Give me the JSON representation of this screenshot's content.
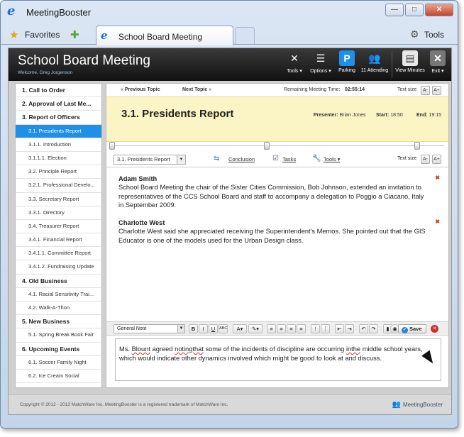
{
  "browser": {
    "title": "MeetingBooster",
    "favorites_label": "Favorites",
    "tab_title": "School Board Meeting",
    "tools_label": "Tools"
  },
  "app": {
    "title": "School Board Meeting",
    "welcome": "Welcome, Greg Jorgenson",
    "header_buttons": [
      "Tools",
      "Options",
      "Parking",
      "11 Attending",
      "View Minutes",
      "Exit"
    ]
  },
  "sidebar": {
    "items": [
      {
        "label": "1. Call to Order",
        "level": "h"
      },
      {
        "label": "2. Approval of Last Me...",
        "level": "h"
      },
      {
        "label": "3. Report of Officers",
        "level": "h"
      },
      {
        "label": "3.1. Presidents Report",
        "level": "sub",
        "active": true
      },
      {
        "label": "3.1.1. Introduction",
        "level": "sub"
      },
      {
        "label": "3.1.1.1. Election",
        "level": "sub"
      },
      {
        "label": "3.2. Principle Report",
        "level": "sub"
      },
      {
        "label": "3.2.1. Professional Develo...",
        "level": "sub"
      },
      {
        "label": "3.3. Secretary Report",
        "level": "sub"
      },
      {
        "label": "3.3.1. Directory",
        "level": "sub"
      },
      {
        "label": "3.4. Treasurer Report",
        "level": "sub"
      },
      {
        "label": "3.4.1. Financial Report",
        "level": "sub"
      },
      {
        "label": "3.4.1.1. Committee Report",
        "level": "sub"
      },
      {
        "label": "3.4.1.2. Fundraising Update",
        "level": "sub"
      },
      {
        "label": "4. Old Business",
        "level": "h"
      },
      {
        "label": "4.1. Racial Sensitivity Trai...",
        "level": "sub"
      },
      {
        "label": "4.2. Walk-A-Thon",
        "level": "sub"
      },
      {
        "label": "5. New Business",
        "level": "h"
      },
      {
        "label": "5.1. Spring Break Book Fair",
        "level": "sub"
      },
      {
        "label": "6. Upcoming Events",
        "level": "h"
      },
      {
        "label": "6.1. Soccer Family Night",
        "level": "sub"
      },
      {
        "label": "6.2. Ice Cream Social",
        "level": "sub"
      },
      {
        "label": "7. Closing Remarks",
        "level": "h"
      }
    ]
  },
  "nav": {
    "previous": "Previous Topic",
    "next": "Next Topic",
    "remaining_label": "Remaining Meeting Time:",
    "remaining_value": "02:55:14",
    "text_size": "Text size"
  },
  "topic": {
    "title": "3.1. Presidents Report",
    "presenter_label": "Presenter:",
    "presenter": "Brian Jones",
    "start_label": "Start:",
    "start": "18:50",
    "end_label": "End:",
    "end": "19:15"
  },
  "toolbar": {
    "topic_select": "3.1. Presidents Report",
    "conclusion": "Conclusion",
    "tasks": "Tasks",
    "tools": "Tools",
    "text_size": "Text size"
  },
  "notes": [
    {
      "author": "Adam Smith",
      "text": "School Board Meeting the chair of the Sister Cities Commission, Bob Johnson, extended an invitation to representatives of the CCS School Board and staff to accompany a delegation to Poggio a Ciacano, Italy in September 2009."
    },
    {
      "author": "Charlotte West",
      "text": "Charlotte West said she appreciated receiving the Superintendent's Memos. She pointed out that the GIS Educator is one of the models used for the Urban Design class."
    }
  ],
  "editor": {
    "style": "General Note",
    "save": "Save",
    "text_parts": [
      "Ms. ",
      "Blount",
      " agreed ",
      "notingthat",
      " some of the incidents of discipline are occurring ",
      "inthe",
      " middle school years, which would indicate other dynamics involved which might be good to look at and discuss."
    ]
  },
  "footer": {
    "copyright": "Copyright © 2012 - 2013 MatchWare Inc. MeetingBooster is a registered trademark of MatchWare Inc.",
    "brand": "MeetingBooster"
  }
}
